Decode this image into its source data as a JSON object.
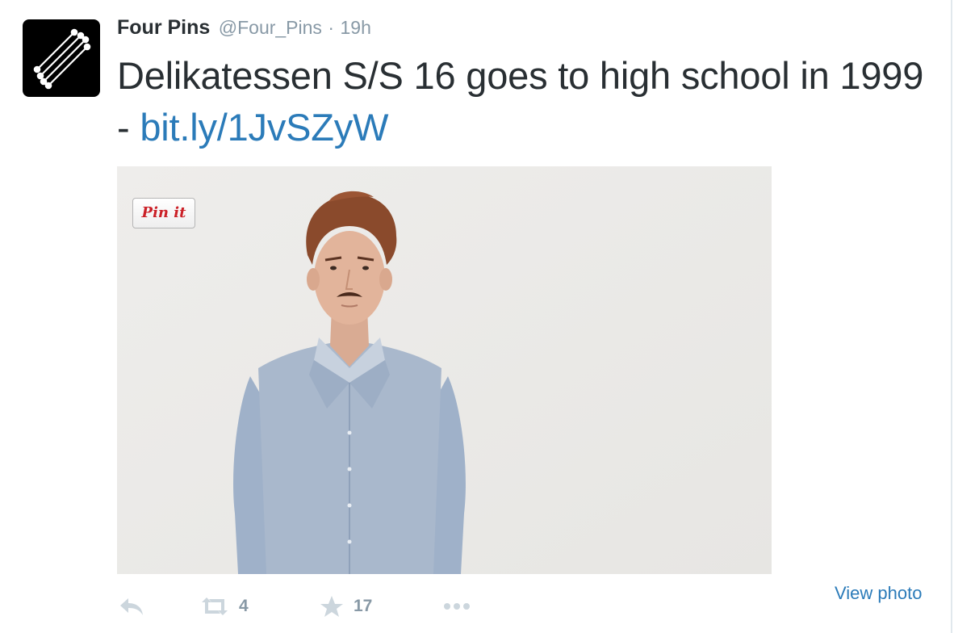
{
  "tweet": {
    "author_name": "Four Pins",
    "author_handle": "@Four_Pins",
    "separator": "·",
    "timestamp": "19h",
    "text": "Delikatessen S/S 16 goes to high school in 1999 - ",
    "link_text": "bit.ly/1JvSZyW"
  },
  "media": {
    "pin_button_label": "Pin it",
    "view_photo_label": "View photo"
  },
  "actions": {
    "retweet_count": "4",
    "favorite_count": "17"
  },
  "colors": {
    "link": "#2b7bb9",
    "text": "#292f33",
    "muted": "#8899a6",
    "action_icon": "#ccd6dd"
  },
  "icons": [
    "avatar-logo",
    "reply-icon",
    "retweet-icon",
    "star-icon",
    "more-icon"
  ]
}
